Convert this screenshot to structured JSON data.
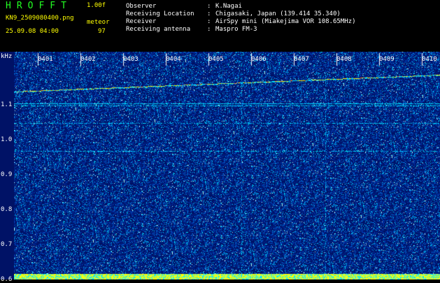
{
  "header": {
    "title": "HROFFT",
    "version": "1.00f",
    "file_name": "KN9_2509080400.png",
    "mode": "meteor",
    "date_time": "25.09.08 04:00",
    "count": "97",
    "metadata": [
      {
        "key": "Observer",
        "value": "K.Nagai"
      },
      {
        "key": "Receiving Location",
        "value": "Chigasaki, Japan (139.414 35.340)"
      },
      {
        "key": "Receiver",
        "value": "AirSpy mini (Miakejima VOR 108.65MHz)"
      },
      {
        "key": "Receiving antenna",
        "value": "Maspro FM-3"
      }
    ]
  },
  "plot": {
    "unit_label": "kHz",
    "freq_ticks": [
      "1.1",
      "1.0",
      "0.9",
      "0.8",
      "0.7",
      "0.6"
    ],
    "freq_range": [
      0.57,
      1.21
    ],
    "time_labels": [
      "0401",
      "0402",
      "0403",
      "0404",
      "0405",
      "0406",
      "0407",
      "0408",
      "0409",
      "0410"
    ],
    "colors": {
      "background": "#001266",
      "noise_high": "#00e5ff",
      "signal": "#ffee00",
      "bottom_band": "#ffff00",
      "tick": "#ffffff"
    }
  }
}
